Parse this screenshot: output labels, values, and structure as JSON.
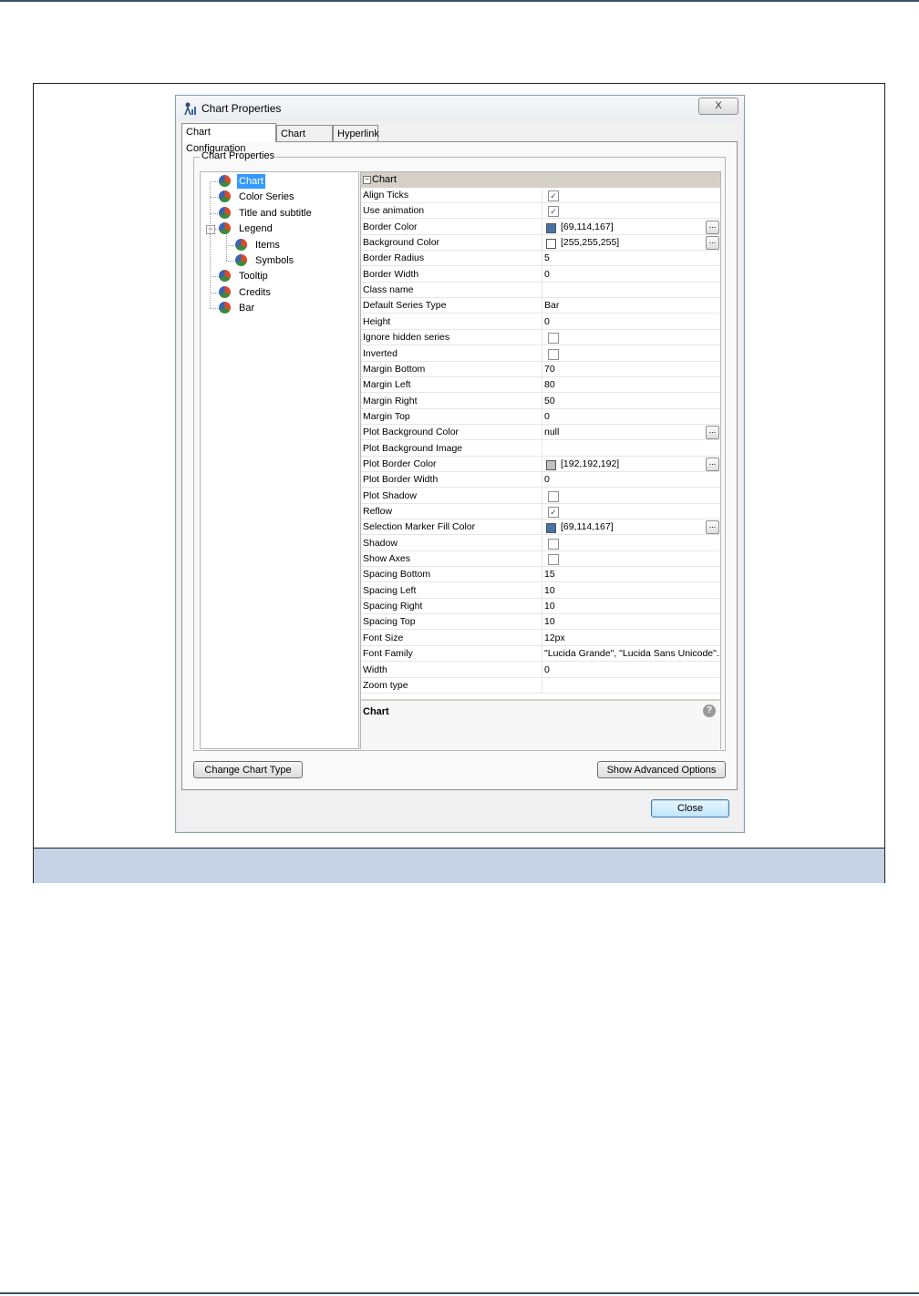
{
  "dialog": {
    "title": "Chart Properties",
    "close_glyph": "X",
    "tabs": [
      {
        "label": "Chart Configuration",
        "active": true
      },
      {
        "label": "Chart Data",
        "active": false
      },
      {
        "label": "Hyperlink",
        "active": false
      }
    ],
    "group_label": "Chart Properties",
    "tree": [
      {
        "label": "Chart",
        "level": 0,
        "selected": true,
        "icon": "chart-node-icon"
      },
      {
        "label": "Color Series",
        "level": 0,
        "selected": false,
        "icon": "chart-node-icon"
      },
      {
        "label": "Title and subtitle",
        "level": 0,
        "selected": false,
        "icon": "chart-node-icon"
      },
      {
        "label": "Legend",
        "level": 0,
        "selected": false,
        "icon": "chart-node-icon",
        "expanded": true
      },
      {
        "label": "Items",
        "level": 1,
        "selected": false,
        "icon": "chart-node-icon"
      },
      {
        "label": "Symbols",
        "level": 1,
        "selected": false,
        "icon": "chart-node-icon"
      },
      {
        "label": "Tooltip",
        "level": 0,
        "selected": false,
        "icon": "chart-node-icon"
      },
      {
        "label": "Credits",
        "level": 0,
        "selected": false,
        "icon": "chart-node-icon"
      },
      {
        "label": "Bar",
        "level": 0,
        "selected": false,
        "icon": "chart-node-icon"
      }
    ],
    "grid": {
      "section": "Chart",
      "expander_glyph": "−",
      "rows": [
        {
          "name": "Align Ticks",
          "type": "check",
          "checked": true
        },
        {
          "name": "Use animation",
          "type": "check",
          "checked": true
        },
        {
          "name": "Border Color",
          "type": "color",
          "value": "[69,114,167]",
          "color": "#4572a7",
          "button": true
        },
        {
          "name": "Background Color",
          "type": "color",
          "value": "[255,255,255]",
          "color": "#ffffff",
          "button": true
        },
        {
          "name": "Border Radius",
          "type": "text",
          "value": "5"
        },
        {
          "name": "Border Width",
          "type": "text",
          "value": "0"
        },
        {
          "name": "Class name",
          "type": "text",
          "value": ""
        },
        {
          "name": "Default Series Type",
          "type": "text",
          "value": "Bar"
        },
        {
          "name": "Height",
          "type": "text",
          "value": "0"
        },
        {
          "name": "Ignore hidden series",
          "type": "check",
          "checked": false
        },
        {
          "name": "Inverted",
          "type": "check",
          "checked": false
        },
        {
          "name": "Margin Bottom",
          "type": "text",
          "value": "70"
        },
        {
          "name": "Margin Left",
          "type": "text",
          "value": "80"
        },
        {
          "name": "Margin Right",
          "type": "text",
          "value": "50"
        },
        {
          "name": "Margin Top",
          "type": "text",
          "value": "0"
        },
        {
          "name": "Plot Background Color",
          "type": "text",
          "value": "null",
          "button": true
        },
        {
          "name": "Plot Background Image",
          "type": "text",
          "value": ""
        },
        {
          "name": "Plot Border Color",
          "type": "color",
          "value": "[192,192,192]",
          "color": "#c0c0c0",
          "button": true
        },
        {
          "name": "Plot Border Width",
          "type": "text",
          "value": "0"
        },
        {
          "name": "Plot Shadow",
          "type": "check",
          "checked": false
        },
        {
          "name": "Reflow",
          "type": "check",
          "checked": true
        },
        {
          "name": "Selection Marker Fill Color",
          "type": "color",
          "value": "[69,114,167]",
          "color": "#4572a7",
          "button": true
        },
        {
          "name": "Shadow",
          "type": "check",
          "checked": false
        },
        {
          "name": "Show Axes",
          "type": "check",
          "checked": false
        },
        {
          "name": "Spacing Bottom",
          "type": "text",
          "value": "15"
        },
        {
          "name": "Spacing Left",
          "type": "text",
          "value": "10"
        },
        {
          "name": "Spacing Right",
          "type": "text",
          "value": "10"
        },
        {
          "name": "Spacing Top",
          "type": "text",
          "value": "10"
        },
        {
          "name": "Font Size",
          "type": "text",
          "value": "12px"
        },
        {
          "name": "Font Family",
          "type": "text",
          "value": "\"Lucida Grande\", \"Lucida Sans Unicode\"..."
        },
        {
          "name": "Width",
          "type": "text",
          "value": "0"
        },
        {
          "name": "Zoom type",
          "type": "text",
          "value": ""
        }
      ],
      "ellipsis_glyph": "...",
      "check_glyph": "✓"
    },
    "description": {
      "title": "Chart",
      "help_glyph": "?"
    },
    "buttons": {
      "change_chart_type": "Change Chart Type",
      "show_advanced": "Show Advanced Options",
      "close": "Close"
    }
  }
}
